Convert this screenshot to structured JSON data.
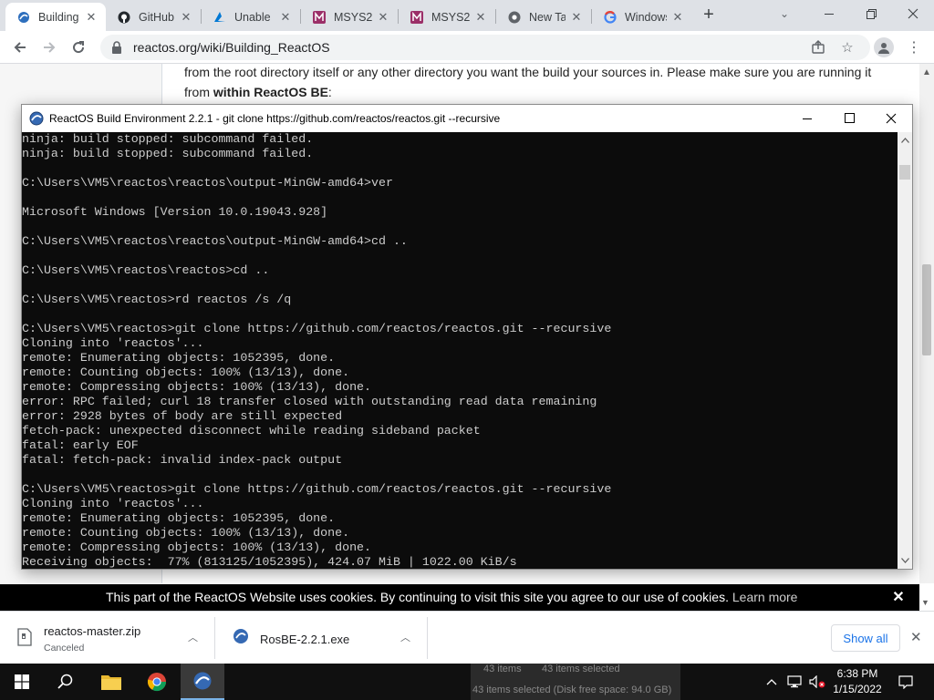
{
  "browser": {
    "tabs": [
      {
        "title": "Building",
        "icon": "reactos-icon",
        "active": true
      },
      {
        "title": "GitHub",
        "icon": "github-icon"
      },
      {
        "title": "Unable",
        "icon": "azure-icon"
      },
      {
        "title": "MSYS2",
        "icon": "msys2-icon"
      },
      {
        "title": "MSYS2",
        "icon": "msys2-icon"
      },
      {
        "title": "New Tab",
        "icon": "chrome-icon"
      },
      {
        "title": "Windows",
        "icon": "google-icon"
      }
    ],
    "url": "reactos.org/wiki/Building_ReactOS"
  },
  "page": {
    "text_line1": "from the root directory itself or any other directory you want the build your sources in. Please make sure you are running it",
    "text_line2_prefix": "from ",
    "text_line2_bold": "within ReactOS BE",
    "text_line2_suffix": ":"
  },
  "console": {
    "title": "ReactOS Build Environment 2.2.1 - git  clone https://github.com/reactos/reactos.git --recursive",
    "lines": [
      "ninja: build stopped: subcommand failed.",
      "ninja: build stopped: subcommand failed.",
      "",
      "C:\\Users\\VM5\\reactos\\reactos\\output-MinGW-amd64>ver",
      "",
      "Microsoft Windows [Version 10.0.19043.928]",
      "",
      "C:\\Users\\VM5\\reactos\\reactos\\output-MinGW-amd64>cd ..",
      "",
      "C:\\Users\\VM5\\reactos\\reactos>cd ..",
      "",
      "C:\\Users\\VM5\\reactos>rd reactos /s /q",
      "",
      "C:\\Users\\VM5\\reactos>git clone https://github.com/reactos/reactos.git --recursive",
      "Cloning into 'reactos'...",
      "remote: Enumerating objects: 1052395, done.",
      "remote: Counting objects: 100% (13/13), done.",
      "remote: Compressing objects: 100% (13/13), done.",
      "error: RPC failed; curl 18 transfer closed with outstanding read data remaining",
      "error: 2928 bytes of body are still expected",
      "fetch-pack: unexpected disconnect while reading sideband packet",
      "fatal: early EOF",
      "fatal: fetch-pack: invalid index-pack output",
      "",
      "C:\\Users\\VM5\\reactos>git clone https://github.com/reactos/reactos.git --recursive",
      "Cloning into 'reactos'...",
      "remote: Enumerating objects: 1052395, done.",
      "remote: Counting objects: 100% (13/13), done.",
      "remote: Compressing objects: 100% (13/13), done.",
      "Receiving objects:  77% (813125/1052395), 424.07 MiB | 1022.00 KiB/s"
    ]
  },
  "cookie": {
    "text": "This part of the ReactOS Website uses cookies. By continuing to visit this site you agree to our use of cookies. ",
    "learn_more": "Learn more"
  },
  "downloads": {
    "items": [
      {
        "name": "reactos-master.zip",
        "status": "Canceled"
      },
      {
        "name": "RosBE-2.2.1.exe",
        "status": ""
      }
    ],
    "show_all": "Show all"
  },
  "taskbar": {
    "ghost_text_1": "43 items",
    "ghost_text_2": "43 items selected",
    "ghost_text_3": "43 items selected (Disk free space: 94.0 GB)",
    "time": "6:38 PM",
    "date": "1/15/2022"
  },
  "colors": {
    "console_bg": "#0c0c0c",
    "console_text": "#cccccc",
    "cookie_bar": "#000000",
    "accent_link": "#1a73e8"
  }
}
